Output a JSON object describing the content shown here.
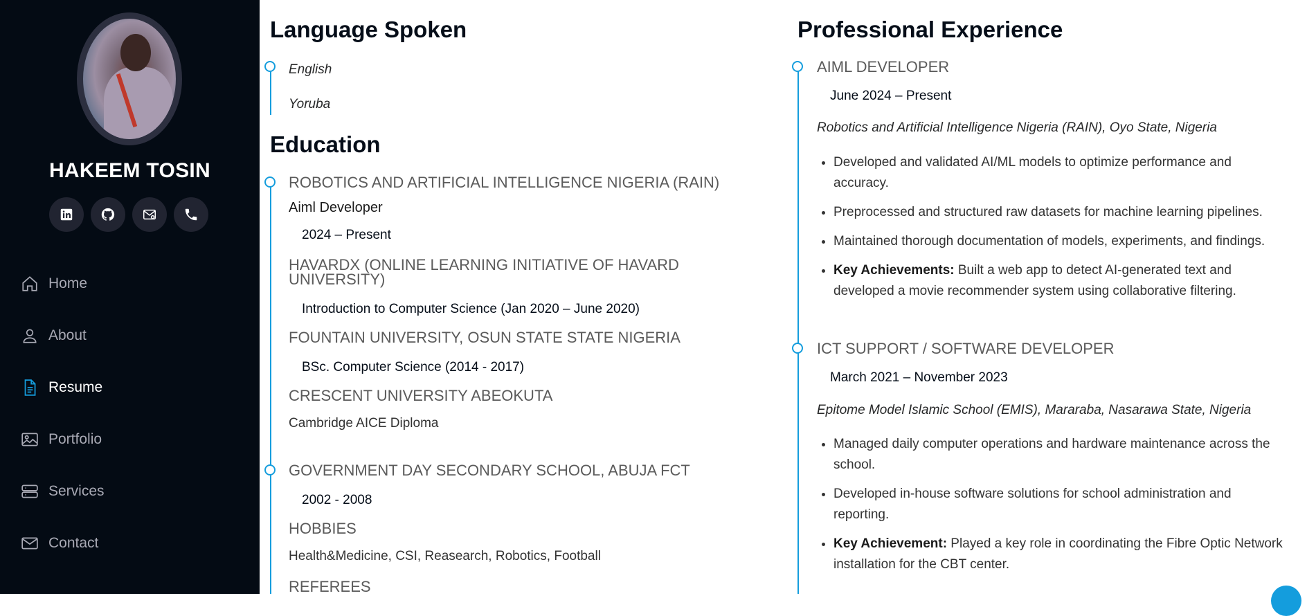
{
  "profile": {
    "name": "HAKEEM TOSIN"
  },
  "socials": [
    "linkedin-icon",
    "github-icon",
    "email-icon",
    "phone-icon"
  ],
  "nav": {
    "items": [
      {
        "label": "Home",
        "icon": "home-icon"
      },
      {
        "label": "About",
        "icon": "person-icon"
      },
      {
        "label": "Resume",
        "icon": "file-icon",
        "active": true
      },
      {
        "label": "Portfolio",
        "icon": "images-icon"
      },
      {
        "label": "Services",
        "icon": "server-icon"
      },
      {
        "label": "Contact",
        "icon": "envelope-icon"
      }
    ]
  },
  "languages": {
    "title": "Language Spoken",
    "items": [
      "English",
      "Yoruba"
    ]
  },
  "education": {
    "title": "Education",
    "entries": [
      {
        "org": "ROBOTICS AND ARTIFICIAL INTELLIGENCE NIGERIA (RAIN)",
        "role": "Aiml Developer",
        "date": "2024 – Present"
      },
      {
        "org_line1": "HAVARDX (ONLINE LEARNING INITIATIVE OF HAVARD",
        "org_line2": "UNIVERSITY)",
        "course": "Introduction to Computer Science (Jan 2020 – June 2020)"
      },
      {
        "org": "FOUNTAIN UNIVERSITY, OSUN STATE STATE NIGERIA",
        "course": "BSc. Computer Science (2014 - 2017)"
      },
      {
        "org": "CRESCENT UNIVERSITY ABEOKUTA",
        "course": "Cambridge AICE Diploma"
      },
      {
        "org": "GOVERNMENT DAY SECONDARY SCHOOL, ABUJA FCT",
        "date": "2002 - 2008"
      }
    ],
    "hobbies": {
      "title": "HOBBIES",
      "text": "Health&Medicine, CSI, Reasearch, Robotics, Football"
    },
    "referees": {
      "title": "REFEREES"
    }
  },
  "experience": {
    "title": "Professional Experience",
    "jobs": [
      {
        "title": "AIML DEVELOPER",
        "date": "June 2024 – Present",
        "company": "Robotics and Artificial Intelligence Nigeria (RAIN), Oyo State, Nigeria",
        "bullets": [
          {
            "text1": "Developed and validated AI/ML models to optimize performance and",
            "text2": "accuracy."
          },
          {
            "text1": "Preprocessed and structured raw datasets for machine learning pipelines."
          },
          {
            "text1": "Maintained thorough documentation of models, experiments, and findings."
          },
          {
            "bold": "Key Achievements:",
            "text1": " Built a web app to detect AI-generated text and",
            "text2": "developed a movie recommender system using collaborative filtering."
          }
        ]
      },
      {
        "title": "ICT SUPPORT / SOFTWARE DEVELOPER",
        "date": "March 2021 – November 2023",
        "company": "Epitome Model Islamic School (EMIS), Mararaba, Nasarawa State, Nigeria",
        "bullets": [
          {
            "text1": "Managed daily computer operations and hardware maintenance across the",
            "text2": "school."
          },
          {
            "text1": "Developed in-house software solutions for school administration and",
            "text2": "reporting."
          },
          {
            "bold": "Key Achievement:",
            "text1": " Played a key role in coordinating the Fibre Optic Network",
            "text2": "installation for the CBT center."
          }
        ]
      }
    ]
  },
  "accent_color": "#149ddd",
  "sidebar_color": "#040b14"
}
